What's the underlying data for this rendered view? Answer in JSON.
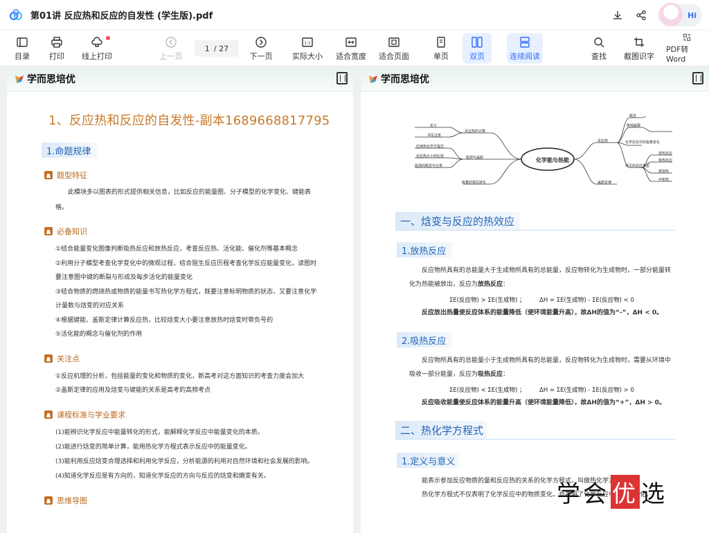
{
  "window": {
    "title": "第01讲 反应热和反应的自发性 (学生版).pdf",
    "avatar_text": "Hi"
  },
  "toolbar": {
    "catalog": "目录",
    "print": "打印",
    "online_print": "线上打印",
    "prev": "上一页",
    "page_current": "1",
    "page_total": "/ 27",
    "next": "下一页",
    "actual_size": "实际大小",
    "fit_width": "适合宽度",
    "fit_page": "适合页面",
    "single": "单页",
    "double": "双页",
    "continuous": "连续阅读",
    "find": "查找",
    "ocr": "截图识字",
    "pdf_word": "PDF转Word"
  },
  "brand": "学而思培优",
  "left_page": {
    "title": "1、反应热和反应的自发性-副本1689668817795",
    "section1": "1.命题规律",
    "sub_features": "题型特征",
    "features_text1": "此模块多以图表的形式提供相关信息，比如反应的能量图、分子模型的化学变化、键能表",
    "features_text2": "格。",
    "sub_knowledge": "必备知识",
    "k1": "①结合能量变化图像判断吸热反应和放热反应，考查反应热、活化能、催化剂等基本概念",
    "k2a": "②利用分子模型考查化学变化中的微观过程，结合阻生反应历程考查化学反应能量变化，读图时",
    "k2b": "要注意图中键的断裂与形成及每步活化的能量变化",
    "k3a": "③结合物质的燃烧热或物质的能量书写热化学方程式，既要注意标明物质的状态，又要注意化学",
    "k3b": "计量数与焓变的对应关系",
    "k4": "④根据键能、盖斯定律计算反应热，比较焓变大小要注意放热时焓变时带负号的",
    "k5": "⑤活化能的概念与催化剂的作用",
    "sub_focus": "关注点",
    "f1": "①反应机理的分析，包括能量的变化和物质的变化，新高考对这方面知识的考查力度会加大",
    "f2": "②盖斯定律的应用及焓变与键能的关系是高考的高频考点",
    "sub_standard": "课程标准与学业要求",
    "s1": "(1)能辨识化学反应中能量转化的形式，能解释化学反应中能量变化的本质。",
    "s2": "(2)能进行焓变的简单计算，能用热化学方程式表示反应中的能量变化。",
    "s3": "(3)能利用反应焓变合理选择和利用化学反应，分析能源的利用对自然环境和社会发展的影响。",
    "s4": "(4)知道化学反应是有方向的，知道化学反应的方向与反应的焓变和熵变有关。",
    "sub_mindmap": "思维导图"
  },
  "right_page": {
    "mindmap_center": "化学能与热能",
    "mm_left": [
      "反应热的计算",
      "能源与盖斯",
      "能量的相互转化"
    ],
    "mm_left_sub": [
      "定义",
      "书写注意",
      "应用热化学方程式",
      "反应热大小的比较",
      "能源的概念与分类"
    ],
    "mm_right": [
      "反应热",
      "盖斯定律"
    ],
    "mm_right_sub": [
      "概念",
      "微观解释",
      "化学反应中的能量变化",
      "常见的反应类型",
      "放热反应",
      "吸热反应",
      "燃烧热",
      "中和热"
    ],
    "h_one": "一、焓变与反应的热效应",
    "sec_exo": "1.放热反应",
    "exo_t1": "反应物所具有的总能量大于生成物所具有的总能量，反应物转化为生成物时，一部分能量转",
    "exo_t2": "化为热能被放出，反应为",
    "exo_t2b": "放热反应",
    "exo_t2c": "：",
    "exo_eq1": "ΣE(反应物) > ΣE(生成物) ；",
    "exo_eq2": "ΔH = ΣE(生成物) - ΣE(反应物) < 0",
    "exo_t3": "反应放出热量使反应体系的能量降低（使环境能量升高），故ΔH的值为“-”，ΔH < 0。",
    "sec_endo": "2.吸热反应",
    "endo_t1": "反应物所具有的总能量小于生成物所具有的总能量，反应物转化为生成物时，需要从环境中",
    "endo_t2": "吸收一部分能量，反应为",
    "endo_t2b": "吸热反应",
    "endo_t2c": "：",
    "endo_eq1": "ΣE(反应物) < ΣE(生成物) ；",
    "endo_eq2": "ΔH = ΣE(生成物) - ΣE(反应物) > 0",
    "endo_t3": "反应吸收能量使反应体系的能量升高（使环境能量降低），故ΔH的值为“+”，ΔH > 0。",
    "h_two": "二、热化学方程式",
    "sec_def": "1.定义与意义",
    "def_t1": "能表示参加反应物质的量和反应热的关系的化学方程式，叫做热化学方程式。",
    "def_t2": "热化学方程式不仅表明了化学反应中的物质变化，也表明了化学反应中的能量变化。"
  },
  "watermark": {
    "part1": "学会",
    "part2": "优",
    "part3": "选"
  }
}
